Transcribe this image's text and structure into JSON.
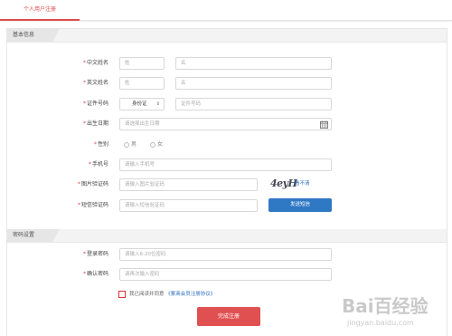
{
  "tab": {
    "label": "个人用户注册"
  },
  "sections": {
    "basic": "基本信息",
    "password": "密码设置"
  },
  "form": {
    "chinese_name": {
      "label": "中文姓名",
      "surname_placeholder": "姓",
      "given_placeholder": "名"
    },
    "english_name": {
      "label": "英文姓名",
      "surname_placeholder": "姓",
      "given_placeholder": "名"
    },
    "id_number": {
      "label": "证件号码",
      "type_value": "身份证",
      "placeholder": "证件号码"
    },
    "birth_date": {
      "label": "出生日期",
      "placeholder": "请选择出生日期"
    },
    "gender": {
      "label": "性别",
      "options": [
        "男",
        "女"
      ]
    },
    "phone": {
      "label": "手机号",
      "placeholder": "请输入手机号"
    },
    "image_code": {
      "label": "图片验证码",
      "placeholder": "请输入图片验证码",
      "captcha_text": "4eyH",
      "refresh_link": "看不清"
    },
    "sms_code": {
      "label": "短信验证码",
      "placeholder": "请输入短信验证码",
      "send_button": "发送短信"
    },
    "login_password": {
      "label": "登录密码",
      "placeholder": "请输入6-20位密码"
    },
    "confirm_password": {
      "label": "确认密码",
      "placeholder": "请再次输入密码"
    },
    "agreement": {
      "text": "我已阅读并同意",
      "link": "《紫商会员注册协议》"
    },
    "submit": "完成注册"
  },
  "watermark": {
    "brand": "Bai百经验",
    "url": "jingyan.baidu.com"
  },
  "colors": {
    "accent_red": "#e04a4a",
    "button_blue": "#2f78c4",
    "submit_red": "#e05050"
  }
}
